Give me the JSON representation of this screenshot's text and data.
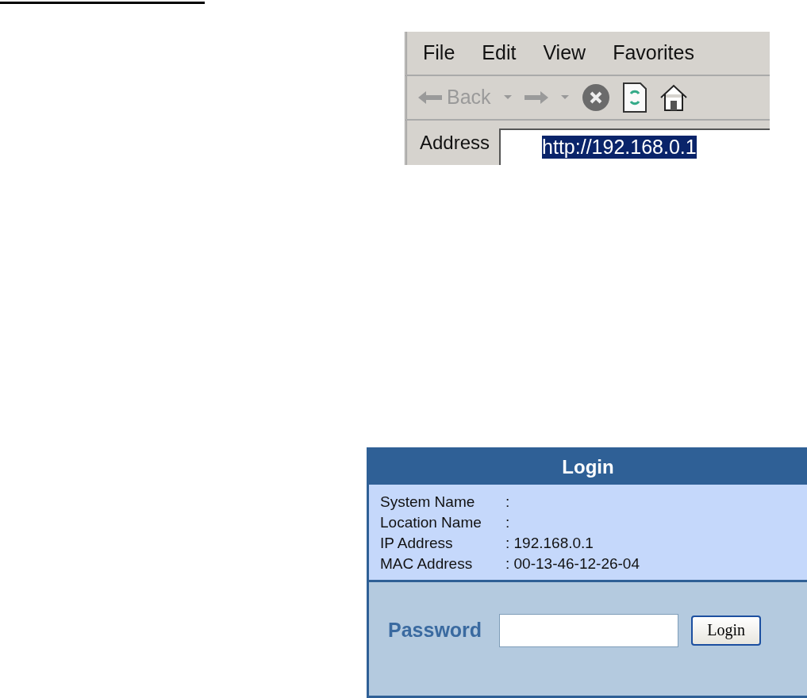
{
  "browser": {
    "menu": [
      "File",
      "Edit",
      "View",
      "Favorites"
    ],
    "toolbar": {
      "back": {
        "label": "Back",
        "disabled": true
      },
      "forward": {
        "disabled": true
      }
    },
    "address": {
      "label": "Address",
      "value": "http://192.168.0.1",
      "selected": true
    }
  },
  "login": {
    "title": "Login",
    "info": [
      {
        "label": "System Name",
        "value": ":"
      },
      {
        "label": "Location Name",
        "value": ":"
      },
      {
        "label": "IP Address",
        "value": ": 192.168.0.1"
      },
      {
        "label": "MAC Address",
        "value": ": 00-13-46-12-26-04"
      }
    ],
    "password": {
      "label": "Password"
    },
    "button": "Login"
  }
}
